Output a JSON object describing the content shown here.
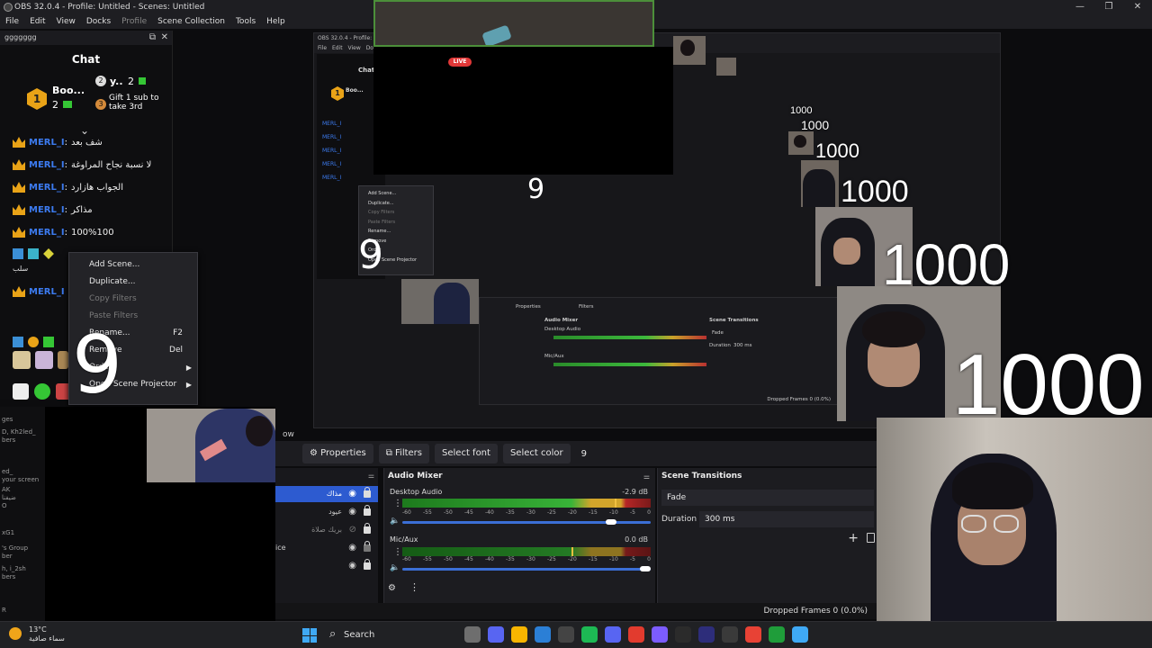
{
  "window": {
    "title": "OBS 32.0.4 - Profile: Untitled - Scenes: Untitled",
    "controls": [
      "—",
      "❐",
      "✕"
    ]
  },
  "menu": [
    "File",
    "Edit",
    "View",
    "Docks",
    "Profile",
    "Scene Collection",
    "Tools",
    "Help"
  ],
  "chat_dock": {
    "header_label": "ggggggg",
    "title": "Chat",
    "leaders": {
      "first_rank": "1",
      "first_name": "Boo...",
      "first_count": "2",
      "second_rank": "2",
      "second_name": "y..",
      "second_count": "2",
      "third_rank": "3",
      "third_text": "Gift 1 sub to take 3rd"
    },
    "messages": [
      {
        "user": "MERL_I",
        "text": "شف بعد"
      },
      {
        "user": "MERL_I",
        "text": "لا نسبة نجاح المراوغة"
      },
      {
        "user": "MERL_I",
        "text": "الجواب هازارد"
      },
      {
        "user": "MERL_I",
        "text": "مذاكر"
      },
      {
        "user": "MERL_I",
        "text": "100%100"
      },
      {
        "user": "MERL_I",
        "text": ""
      }
    ],
    "misc_text": "سلب"
  },
  "context_menu": {
    "items": [
      {
        "label": "Add Scene...",
        "shortcut": "",
        "disabled": false,
        "submenu": false
      },
      {
        "label": "Duplicate...",
        "shortcut": "",
        "disabled": false,
        "submenu": false
      },
      {
        "label": "Copy Filters",
        "shortcut": "",
        "disabled": true,
        "submenu": false
      },
      {
        "label": "Paste Filters",
        "shortcut": "",
        "disabled": true,
        "submenu": false
      },
      {
        "label": "Rename...",
        "shortcut": "F2",
        "disabled": false,
        "submenu": false
      },
      {
        "label": "Remove",
        "shortcut": "Del",
        "disabled": false,
        "submenu": false
      },
      {
        "label": "Order",
        "shortcut": "",
        "disabled": false,
        "submenu": true
      },
      {
        "label": "Open Scene Projector",
        "shortcut": "",
        "disabled": false,
        "submenu": true
      }
    ]
  },
  "overlay_numbers": {
    "nine": "9",
    "counts": [
      "1000",
      "1000",
      "1000",
      "1000",
      "1000",
      "1000"
    ]
  },
  "live_badge": "LIVE",
  "left_lower": [
    "ges",
    "D, Kh2led_",
    "bers",
    "ed_",
    "your screen",
    "AK",
    "ضيفنا",
    "O",
    "xG1",
    "'s Group",
    "ber",
    "h, i_2sh",
    "bers",
    "R"
  ],
  "source_toolbar": {
    "label": "ow",
    "buttons": [
      "Properties",
      "Filters",
      "Select font",
      "Select color"
    ],
    "value": "9"
  },
  "scenes": [
    {
      "name": "مذاك",
      "selected": true
    },
    {
      "name": "عيود",
      "selected": false
    },
    {
      "name": "بريك صلاة",
      "selected": false
    },
    {
      "name": "ice",
      "selected": false
    },
    {
      "name": "",
      "selected": false
    }
  ],
  "audio_mixer": {
    "title": "Audio Mixer",
    "ticks": [
      "-60",
      "-55",
      "-50",
      "-45",
      "-40",
      "-35",
      "-30",
      "-25",
      "-20",
      "-15",
      "-10",
      "-5",
      "0"
    ],
    "tracks": [
      {
        "name": "Desktop Audio",
        "db": "-2.9 dB",
        "level": 0.93,
        "volume": 0.8
      },
      {
        "name": "Mic/Aux",
        "db": "0.0 dB",
        "level": 0.65,
        "volume": 1.0
      }
    ]
  },
  "scene_transitions": {
    "title": "Scene Transitions",
    "selected": "Fade",
    "duration_label": "Duration",
    "duration_value": "300 ms"
  },
  "status": {
    "dropped_frames": "Dropped Frames 0 (0.0%)"
  },
  "taskbar": {
    "weather_temp": "13°C",
    "weather_desc": "سماء صافية",
    "search": "Search",
    "app_colors": [
      "#6e6e6e",
      "#5865f2",
      "#f7b500",
      "#2b7fd6",
      "#444444",
      "#1db954",
      "#5865f2",
      "#e23b2e",
      "#7c5cff",
      "#2b2b2b",
      "#2d2d7a",
      "#3a3a3a",
      "#e84235",
      "#1f9d3a",
      "#3fa9f5"
    ]
  }
}
